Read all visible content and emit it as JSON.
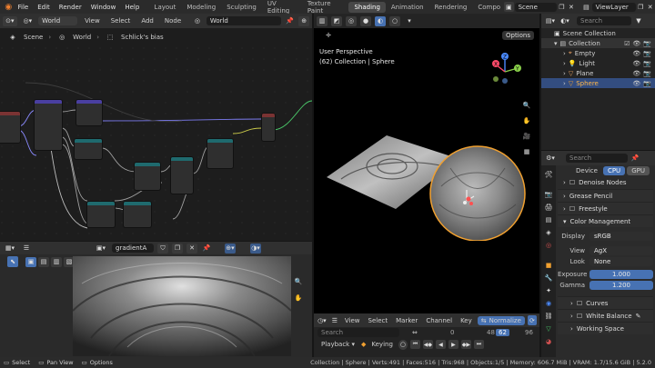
{
  "topbar": {
    "menus": [
      "File",
      "Edit",
      "Render",
      "Window",
      "Help"
    ],
    "workspaces": [
      "Layout",
      "Modeling",
      "Sculpting",
      "UV Editing",
      "Texture Paint",
      "Shading",
      "Animation",
      "Rendering",
      "Compo"
    ],
    "active_workspace": "Shading",
    "scene": "Scene",
    "view_layer": "ViewLayer"
  },
  "node_editor": {
    "world_selector": "World",
    "menus": [
      "View",
      "Select",
      "Add",
      "Node"
    ],
    "world_name": "World",
    "breadcrumbs": [
      "Scene",
      "World",
      "Schlick's bias"
    ]
  },
  "image_editor": {
    "image_name": "gradientA"
  },
  "viewport": {
    "options_label": "Options",
    "perspective": "User Perspective",
    "collection_info": "(62) Collection | Sphere",
    "gizmo_axes": [
      "Z",
      "Y",
      "X"
    ]
  },
  "timeline": {
    "menus": [
      "View",
      "Select",
      "Marker",
      "Channel",
      "Key"
    ],
    "normalize": "Normalize",
    "search_placeholder": "Search",
    "playback": "Playback",
    "keying": "Keying",
    "frame_start_marker": "0",
    "current_frame": "62",
    "frame_48": "48",
    "frame_96": "96"
  },
  "outliner": {
    "search_placeholder": "Search",
    "scene_collection": "Scene Collection",
    "items": [
      {
        "label": "Collection",
        "color": "#e8e8e8"
      },
      {
        "label": "Empty",
        "color": "#e8a060"
      },
      {
        "label": "Light",
        "color": "#e8a060"
      },
      {
        "label": "Plane",
        "color": "#e8a060"
      },
      {
        "label": "Sphere",
        "color": "#e8a060"
      }
    ],
    "selected": "Sphere"
  },
  "properties": {
    "search_placeholder": "Search",
    "device_label": "Device",
    "device_options": [
      "CPU",
      "GPU"
    ],
    "device_selected": "CPU",
    "panels": {
      "denoise": "Denoise Nodes",
      "grease_pencil": "Grease Pencil",
      "freestyle": "Freestyle",
      "color_management": "Color Management",
      "curves": "Curves",
      "white_balance": "White Balance",
      "working_space": "Working Space"
    },
    "display_label": "Display",
    "display_value": "sRGB",
    "view_label": "View",
    "view_value": "AgX",
    "look_label": "Look",
    "look_value": "None",
    "exposure_label": "Exposure",
    "exposure_value": "1.000",
    "gamma_label": "Gamma",
    "gamma_value": "1.200"
  },
  "statusbar": {
    "select": "Select",
    "pan_view": "Pan View",
    "options": "Options",
    "stats": "Collection | Sphere | Verts:491 | Faces:516 | Tris:968 | Objects:1/5 | Memory: 606.7 MiB | VRAM: 1.7/15.6 GiB | 5.2.0"
  },
  "colors": {
    "accent_blue": "#4772b3",
    "selection_orange": "#f0a030"
  }
}
